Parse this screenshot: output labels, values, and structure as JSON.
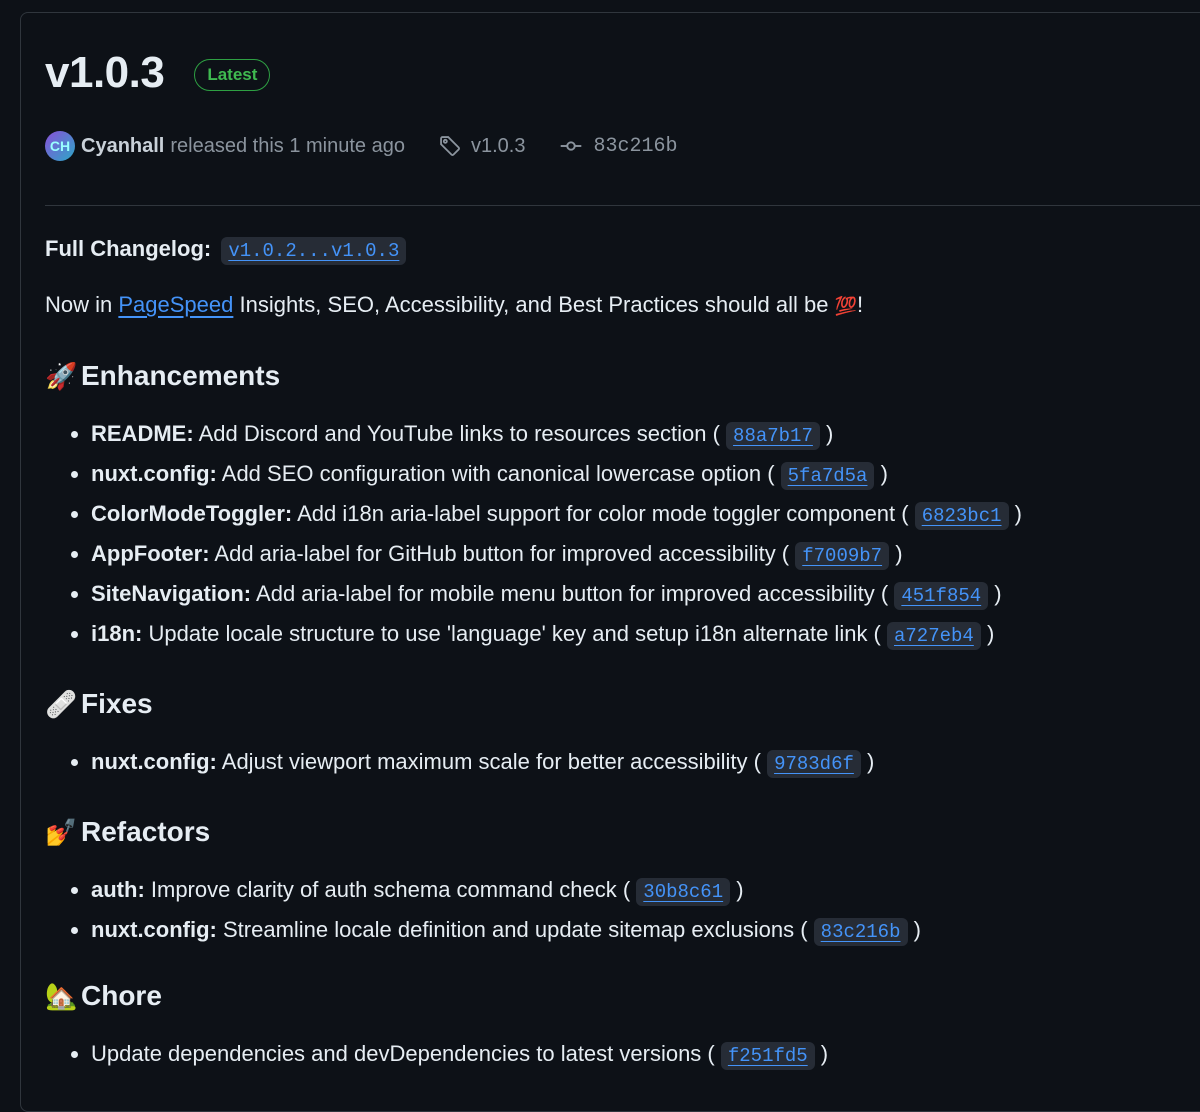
{
  "release": {
    "title": "v1.0.3",
    "badge": "Latest",
    "avatar_initials": "CH",
    "author": "Cyanhall",
    "released_text": "released this 1 minute ago",
    "tag": "v1.0.3",
    "commit": "83c216b"
  },
  "changelog": {
    "label": "Full Changelog:",
    "range": "v1.0.2...v1.0.3"
  },
  "intro": {
    "before": "Now in ",
    "link": "PageSpeed",
    "after": " Insights, SEO, Accessibility, and Best Practices should all be ",
    "emoji": "💯",
    "end": "!"
  },
  "sections": {
    "enhancements": {
      "emoji": "🚀",
      "title": "Enhancements",
      "items": [
        {
          "scope": "README:",
          "text": " Add Discord and YouTube links to resources section ( ",
          "hash": "88a7b17"
        },
        {
          "scope": "nuxt.config:",
          "text": " Add SEO configuration with canonical lowercase option ( ",
          "hash": "5fa7d5a"
        },
        {
          "scope": "ColorModeToggler:",
          "text": " Add i18n aria-label support for color mode toggler component ( ",
          "hash": "6823bc1"
        },
        {
          "scope": "AppFooter:",
          "text": " Add aria-label for GitHub button for improved accessibility ( ",
          "hash": "f7009b7"
        },
        {
          "scope": "SiteNavigation:",
          "text": " Add aria-label for mobile menu button for improved accessibility ( ",
          "hash": "451f854"
        },
        {
          "scope": "i18n:",
          "text": " Update locale structure to use 'language' key and setup i18n alternate link ( ",
          "hash": "a727eb4"
        }
      ]
    },
    "fixes": {
      "emoji": "🩹",
      "title": "Fixes",
      "items": [
        {
          "scope": "nuxt.config:",
          "text": " Adjust viewport maximum scale for better accessibility ( ",
          "hash": "9783d6f"
        }
      ]
    },
    "refactors": {
      "emoji": "💅",
      "title": "Refactors",
      "items": [
        {
          "scope": "auth:",
          "text": " Improve clarity of auth schema command check ( ",
          "hash": "30b8c61"
        },
        {
          "scope": "nuxt.config:",
          "text": " Streamline locale definition and update sitemap exclusions ( ",
          "hash": "83c216b"
        }
      ]
    },
    "chore": {
      "emoji": "🏡",
      "title": "Chore",
      "items": [
        {
          "scope": "",
          "text": "Update dependencies and devDependencies to latest versions ( ",
          "hash": "f251fd5"
        }
      ]
    }
  },
  "close_paren": " )",
  "icons": {
    "tag": "tag-icon",
    "commit": "git-commit-icon"
  }
}
